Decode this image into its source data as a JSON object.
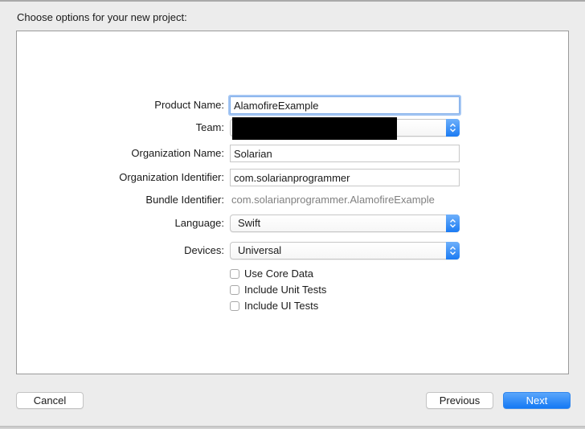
{
  "dialog": {
    "heading": "Choose options for your new project:"
  },
  "form": {
    "product_name": {
      "label": "Product Name:",
      "value": "AlamofireExample"
    },
    "team": {
      "label": "Team:",
      "value": ""
    },
    "organization_name": {
      "label": "Organization Name:",
      "value": "Solarian"
    },
    "organization_identifier": {
      "label": "Organization Identifier:",
      "value": "com.solarianprogrammer"
    },
    "bundle_identifier": {
      "label": "Bundle Identifier:",
      "value": "com.solarianprogrammer.AlamofireExample"
    },
    "language": {
      "label": "Language:",
      "value": "Swift"
    },
    "devices": {
      "label": "Devices:",
      "value": "Universal"
    },
    "checkboxes": [
      {
        "label": "Use Core Data",
        "checked": false
      },
      {
        "label": "Include Unit Tests",
        "checked": false
      },
      {
        "label": "Include UI Tests",
        "checked": false
      }
    ]
  },
  "buttons": {
    "cancel": "Cancel",
    "previous": "Previous",
    "next": "Next"
  },
  "colors": {
    "accent": "#1b7bf3",
    "focus_ring": "#a4c6f3"
  }
}
